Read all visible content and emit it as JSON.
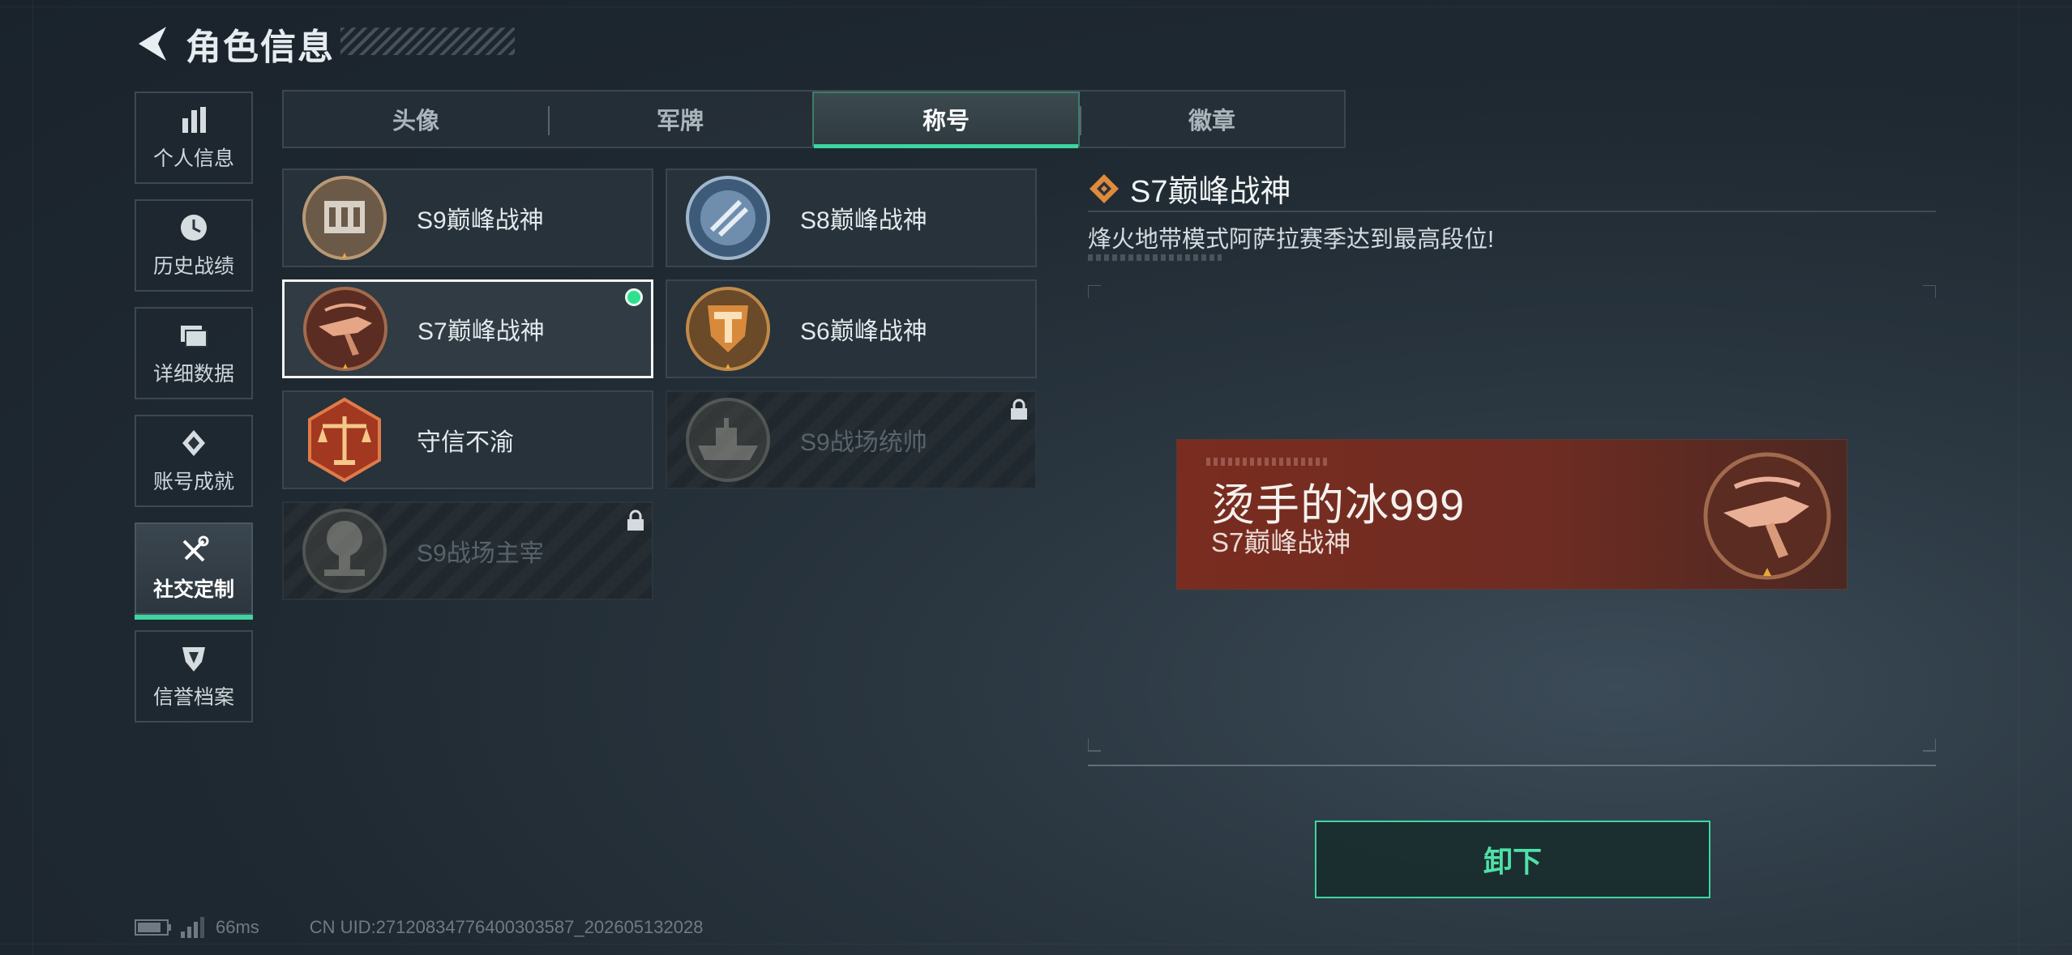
{
  "header": {
    "title": "角色信息"
  },
  "sidebar": {
    "items": [
      {
        "label": "个人信息",
        "icon": "bar-chart-icon"
      },
      {
        "label": "历史战绩",
        "icon": "clock-icon"
      },
      {
        "label": "详细数据",
        "icon": "folder-icon"
      },
      {
        "label": "账号成就",
        "icon": "medal-icon"
      },
      {
        "label": "社交定制",
        "icon": "tools-icon",
        "active": true
      },
      {
        "label": "信誉档案",
        "icon": "shield-icon"
      }
    ]
  },
  "tabs": [
    {
      "label": "头像"
    },
    {
      "label": "军牌"
    },
    {
      "label": "称号",
      "active": true
    },
    {
      "label": "徽章"
    }
  ],
  "titles": [
    {
      "label": "S9巅峰战神",
      "badge": "building-badge",
      "state": "unlocked"
    },
    {
      "label": "S8巅峰战神",
      "badge": "blue-emblem-badge",
      "state": "unlocked"
    },
    {
      "label": "S7巅峰战神",
      "badge": "crossbow-badge",
      "state": "selected",
      "equipped": true
    },
    {
      "label": "S6巅峰战神",
      "badge": "shield-t-badge",
      "state": "unlocked"
    },
    {
      "label": "守信不渝",
      "badge": "scales-badge",
      "state": "unlocked"
    },
    {
      "label": "S9战场统帅",
      "badge": "warship-badge",
      "state": "locked"
    },
    {
      "label": "S9战场主宰",
      "badge": "explosion-badge",
      "state": "locked"
    }
  ],
  "detail": {
    "title": "S7巅峰战神",
    "description": "烽火地带模式阿萨拉赛季达到最高段位!"
  },
  "preview": {
    "player_name": "烫手的冰999",
    "title": "S7巅峰战神"
  },
  "actions": {
    "unequip_label": "卸下"
  },
  "footer": {
    "ping": "66ms",
    "uid": "CN UID:2712083477640030358​7_202605132028"
  },
  "colors": {
    "accent": "#3dd6a0",
    "equipped_dot": "#2fe08e",
    "preview_bg": "#7a2c20",
    "badge_orange": "#e08a3c"
  }
}
